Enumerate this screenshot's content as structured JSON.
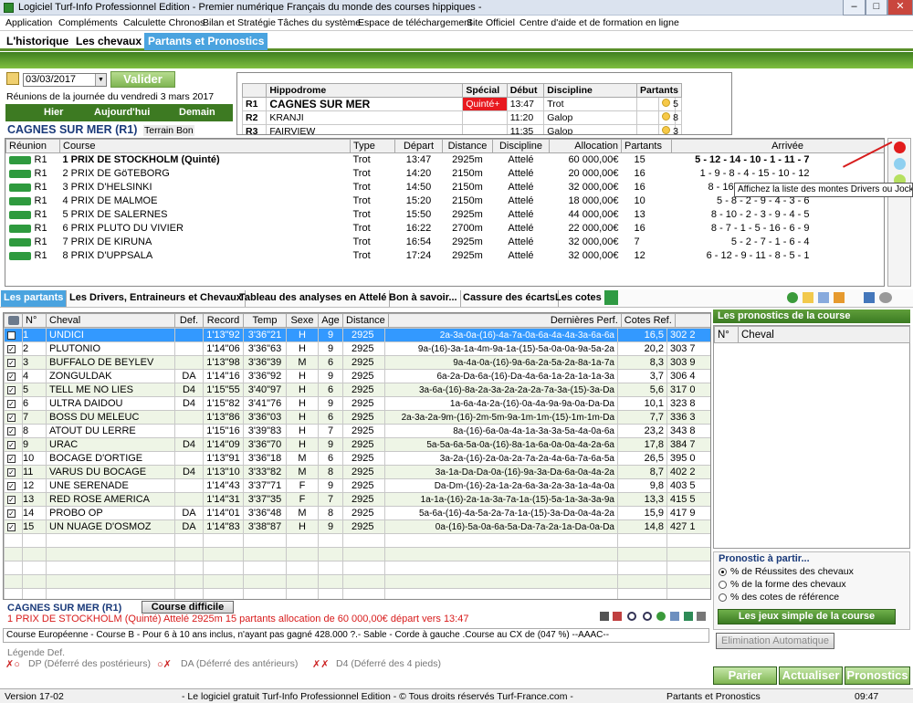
{
  "window": {
    "title": "Logiciel Turf-Info Professionnel Edition - Premier numérique Français du monde des courses hippiques -"
  },
  "menu": [
    "Application",
    "Compléments",
    "Calculette Chronos",
    "Bilan et Stratégie",
    "Tâches du système",
    "Espace de téléchargement",
    "Site Officiel",
    "Centre d'aide et de formation en ligne"
  ],
  "top_tabs": [
    "L'historique",
    "Les chevaux",
    "Partants et Pronostics"
  ],
  "date_panel": {
    "date": "03/03/2017",
    "valider": "Valider",
    "reunion_text": "Réunions de la journée du vendredi 3 mars 2017",
    "hier": "Hier",
    "aujourdhui": "Aujourd'hui",
    "demain": "Demain",
    "reunion_title": "CAGNES SUR MER (R1)",
    "terrain": "Terrain Bon"
  },
  "hippodromes": {
    "headers": [
      "Hippodrome",
      "Spécial",
      "Début",
      "Discipline",
      "Partants"
    ],
    "rows": [
      {
        "r": "R1",
        "name": "CAGNES SUR MER",
        "special": "Quinté+",
        "debut": "13:47",
        "discipline": "Trot",
        "partants": "5"
      },
      {
        "r": "R2",
        "name": "KRANJI",
        "special": "",
        "debut": "11:20",
        "discipline": "Galop",
        "partants": "8"
      },
      {
        "r": "R3",
        "name": "FAIRVIEW",
        "special": "",
        "debut": "11:35",
        "discipline": "Galop",
        "partants": "3"
      }
    ]
  },
  "courses": {
    "headers": [
      "Réunion",
      "Course",
      "Type",
      "Départ",
      "Distance",
      "Discipline",
      "Allocation",
      "Partants",
      "Arrivée"
    ],
    "rows": [
      {
        "reunion": "R1",
        "course": "1 PRIX DE STOCKHOLM (Quinté)",
        "type": "Trot",
        "depart": "13:47",
        "distance": "2925m",
        "discipline": "Attelé",
        "allocation": "60 000,00€",
        "partants": "15",
        "arrivee": "5 - 12 - 14 - 10 - 1 - 11 - 7"
      },
      {
        "reunion": "R1",
        "course": "2 PRIX DE GöTEBORG",
        "type": "Trot",
        "depart": "14:20",
        "distance": "2150m",
        "discipline": "Attelé",
        "allocation": "20 000,00€",
        "partants": "16",
        "arrivee": "1 - 9 - 8 - 4 - 15 - 10 - 12"
      },
      {
        "reunion": "R1",
        "course": "3 PRIX D'HELSINKI",
        "type": "Trot",
        "depart": "14:50",
        "distance": "2150m",
        "discipline": "Attelé",
        "allocation": "32 000,00€",
        "partants": "16",
        "arrivee": "8 - 16 -"
      },
      {
        "reunion": "R1",
        "course": "4 PRIX DE MALMOE",
        "type": "Trot",
        "depart": "15:20",
        "distance": "2150m",
        "discipline": "Attelé",
        "allocation": "18 000,00€",
        "partants": "10",
        "arrivee": "5 - 8 - 2 - 9 - 4 - 3 - 6"
      },
      {
        "reunion": "R1",
        "course": "5 PRIX DE SALERNES",
        "type": "Trot",
        "depart": "15:50",
        "distance": "2925m",
        "discipline": "Attelé",
        "allocation": "44 000,00€",
        "partants": "13",
        "arrivee": "8 - 10 - 2 - 3 - 9 - 4 - 5"
      },
      {
        "reunion": "R1",
        "course": "6 PRIX PLUTO DU VIVIER",
        "type": "Trot",
        "depart": "16:22",
        "distance": "2700m",
        "discipline": "Attelé",
        "allocation": "22 000,00€",
        "partants": "16",
        "arrivee": "8 - 7 - 1 - 5 - 16 - 6 - 9"
      },
      {
        "reunion": "R1",
        "course": "7 PRIX DE KIRUNA",
        "type": "Trot",
        "depart": "16:54",
        "distance": "2925m",
        "discipline": "Attelé",
        "allocation": "32 000,00€",
        "partants": "7",
        "arrivee": "5 - 2 - 7 - 1 - 6 - 4"
      },
      {
        "reunion": "R1",
        "course": "8 PRIX D'UPPSALA",
        "type": "Trot",
        "depart": "17:24",
        "distance": "2925m",
        "discipline": "Attelé",
        "allocation": "32 000,00€",
        "partants": "12",
        "arrivee": "6 - 12 - 9 - 11 - 8 - 5 - 1"
      }
    ]
  },
  "tooltip": "Affichez la liste des montes Drivers ou Jockeys",
  "mid_tabs": [
    "Les partants",
    "Les Drivers, Entraineurs et Chevaux",
    "Tableau des analyses en Attelé",
    "Bon à savoir...",
    "Cassure des écarts",
    "Les cotes"
  ],
  "partants": {
    "headers": [
      "N°",
      "Cheval",
      "Def.",
      "Record",
      "Temp",
      "Sexe",
      "Age",
      "Distance",
      "Dernières Perf.",
      "Cotes Ref."
    ],
    "rows": [
      {
        "n": "1",
        "cheval": "UNDICI",
        "def": "",
        "record": "1'13\"92",
        "temp": "3'36\"21",
        "sexe": "H",
        "age": "9",
        "dist": "2925",
        "perf": "2a-3a-0a-(16)-4a-7a-0a-6a-4a-4a-3a-6a-6a",
        "cote": "16,5",
        "extra": "302 2"
      },
      {
        "n": "2",
        "cheval": "PLUTONIO",
        "def": "",
        "record": "1'14\"06",
        "temp": "3'36\"63",
        "sexe": "H",
        "age": "9",
        "dist": "2925",
        "perf": "9a-(16)-3a-1a-4m-9a-1a-(15)-5a-0a-0a-9a-5a-2a",
        "cote": "20,2",
        "extra": "303 7"
      },
      {
        "n": "3",
        "cheval": "BUFFALO DE BEYLEV",
        "def": "",
        "record": "1'13\"98",
        "temp": "3'36\"39",
        "sexe": "M",
        "age": "6",
        "dist": "2925",
        "perf": "9a-4a-0a-(16)-9a-6a-2a-5a-2a-8a-1a-7a",
        "cote": "8,3",
        "extra": "303 9"
      },
      {
        "n": "4",
        "cheval": "ZONGULDAK",
        "def": "DA",
        "record": "1'14\"16",
        "temp": "3'36\"92",
        "sexe": "H",
        "age": "9",
        "dist": "2925",
        "perf": "6a-2a-Da-6a-(16)-Da-4a-6a-1a-2a-1a-1a-3a",
        "cote": "3,7",
        "extra": "306 4"
      },
      {
        "n": "5",
        "cheval": "TELL ME NO LIES",
        "def": "D4",
        "record": "1'15\"55",
        "temp": "3'40\"97",
        "sexe": "H",
        "age": "6",
        "dist": "2925",
        "perf": "3a-6a-(16)-8a-2a-3a-2a-2a-2a-7a-3a-(15)-3a-Da",
        "cote": "5,6",
        "extra": "317 0"
      },
      {
        "n": "6",
        "cheval": "ULTRA DAIDOU",
        "def": "D4",
        "record": "1'15\"82",
        "temp": "3'41\"76",
        "sexe": "H",
        "age": "9",
        "dist": "2925",
        "perf": "1a-6a-4a-2a-(16)-0a-4a-9a-9a-0a-Da-Da",
        "cote": "10,1",
        "extra": "323 8"
      },
      {
        "n": "7",
        "cheval": "BOSS DU MELEUC",
        "def": "",
        "record": "1'13\"86",
        "temp": "3'36\"03",
        "sexe": "H",
        "age": "6",
        "dist": "2925",
        "perf": "2a-3a-2a-9m-(16)-2m-5m-9a-1m-1m-(15)-1m-1m-Da",
        "cote": "7,7",
        "extra": "336 3"
      },
      {
        "n": "8",
        "cheval": "ATOUT DU LERRE",
        "def": "",
        "record": "1'15\"16",
        "temp": "3'39\"83",
        "sexe": "H",
        "age": "7",
        "dist": "2925",
        "perf": "8a-(16)-6a-0a-4a-1a-3a-3a-5a-4a-0a-6a",
        "cote": "23,2",
        "extra": "343 8"
      },
      {
        "n": "9",
        "cheval": "URAC",
        "def": "D4",
        "record": "1'14\"09",
        "temp": "3'36\"70",
        "sexe": "H",
        "age": "9",
        "dist": "2925",
        "perf": "5a-5a-6a-5a-0a-(16)-8a-1a-6a-0a-0a-4a-2a-6a",
        "cote": "17,8",
        "extra": "384 7"
      },
      {
        "n": "10",
        "cheval": "BOCAGE D'ORTIGE",
        "def": "",
        "record": "1'13\"91",
        "temp": "3'36\"18",
        "sexe": "M",
        "age": "6",
        "dist": "2925",
        "perf": "3a-2a-(16)-2a-0a-2a-7a-2a-4a-6a-7a-6a-5a",
        "cote": "26,5",
        "extra": "395 0"
      },
      {
        "n": "11",
        "cheval": "VARUS DU BOCAGE",
        "def": "D4",
        "record": "1'13\"10",
        "temp": "3'33\"82",
        "sexe": "M",
        "age": "8",
        "dist": "2925",
        "perf": "3a-1a-Da-Da-0a-(16)-9a-3a-Da-6a-0a-4a-2a",
        "cote": "8,7",
        "extra": "402 2"
      },
      {
        "n": "12",
        "cheval": "UNE SERENADE",
        "def": "",
        "record": "1'14\"43",
        "temp": "3'37\"71",
        "sexe": "F",
        "age": "9",
        "dist": "2925",
        "perf": "Da-Dm-(16)-2a-1a-2a-6a-3a-2a-3a-1a-4a-0a",
        "cote": "9,8",
        "extra": "403 5"
      },
      {
        "n": "13",
        "cheval": "RED ROSE AMERICA",
        "def": "",
        "record": "1'14\"31",
        "temp": "3'37\"35",
        "sexe": "F",
        "age": "7",
        "dist": "2925",
        "perf": "1a-1a-(16)-2a-1a-3a-7a-1a-(15)-5a-1a-3a-3a-9a",
        "cote": "13,3",
        "extra": "415 5"
      },
      {
        "n": "14",
        "cheval": "PROBO OP",
        "def": "DA",
        "record": "1'14\"01",
        "temp": "3'36\"48",
        "sexe": "M",
        "age": "8",
        "dist": "2925",
        "perf": "5a-6a-(16)-4a-5a-2a-7a-1a-(15)-3a-Da-0a-4a-2a",
        "cote": "15,9",
        "extra": "417 9"
      },
      {
        "n": "15",
        "cheval": "UN NUAGE D'OSMOZ",
        "def": "DA",
        "record": "1'14\"83",
        "temp": "3'38\"87",
        "sexe": "H",
        "age": "9",
        "dist": "2925",
        "perf": "0a-(16)-5a-0a-6a-5a-Da-7a-2a-1a-Da-0a-Da",
        "cote": "14,8",
        "extra": "427 1"
      }
    ]
  },
  "course_footer": {
    "title": "CAGNES SUR MER (R1)",
    "difficulty": "Course difficile",
    "summary": "1 PRIX DE STOCKHOLM (Quinté) Attelé 2925m 15 partants allocation de 60 000,00€ départ vers 13:47",
    "description": "Course Européenne - Course B - Pour 6 à 10 ans inclus, n'ayant pas gagné 428.000 ?.- Sable - Corde à gauche .Course au CX de (047 %) --AAAC--"
  },
  "legende": {
    "title": "Légende Def.",
    "items": [
      "DP (Déferré des postérieurs)",
      "DA (Déferré des antérieurs)",
      "D4 (Déferré des 4 pieds)"
    ]
  },
  "pronostics": {
    "title": "Les pronostics de la course",
    "headers": [
      "N°",
      "Cheval"
    ],
    "partir_title": "Pronostic à partir...",
    "options": [
      "% de Réussites des chevaux",
      "% de la forme des chevaux",
      "% des cotes de référence"
    ],
    "jeux_button": "Les jeux simple de la course",
    "elimination_button": "Elimination Automatique",
    "bottom_buttons": [
      "Parier",
      "Actualiser",
      "Pronostics"
    ]
  },
  "status": {
    "version": "Version 17-02",
    "center": "- Le logiciel gratuit Turf-Info Professionnel Edition - © Tous droits réservés Turf-France.com -",
    "module": "Partants et Pronostics",
    "time": "09:47"
  },
  "colors": {
    "green_dark": "#3a7a22",
    "selected_row": "#3399ff",
    "special_red": "#e8191f",
    "active_tab": "#4aa3df"
  }
}
